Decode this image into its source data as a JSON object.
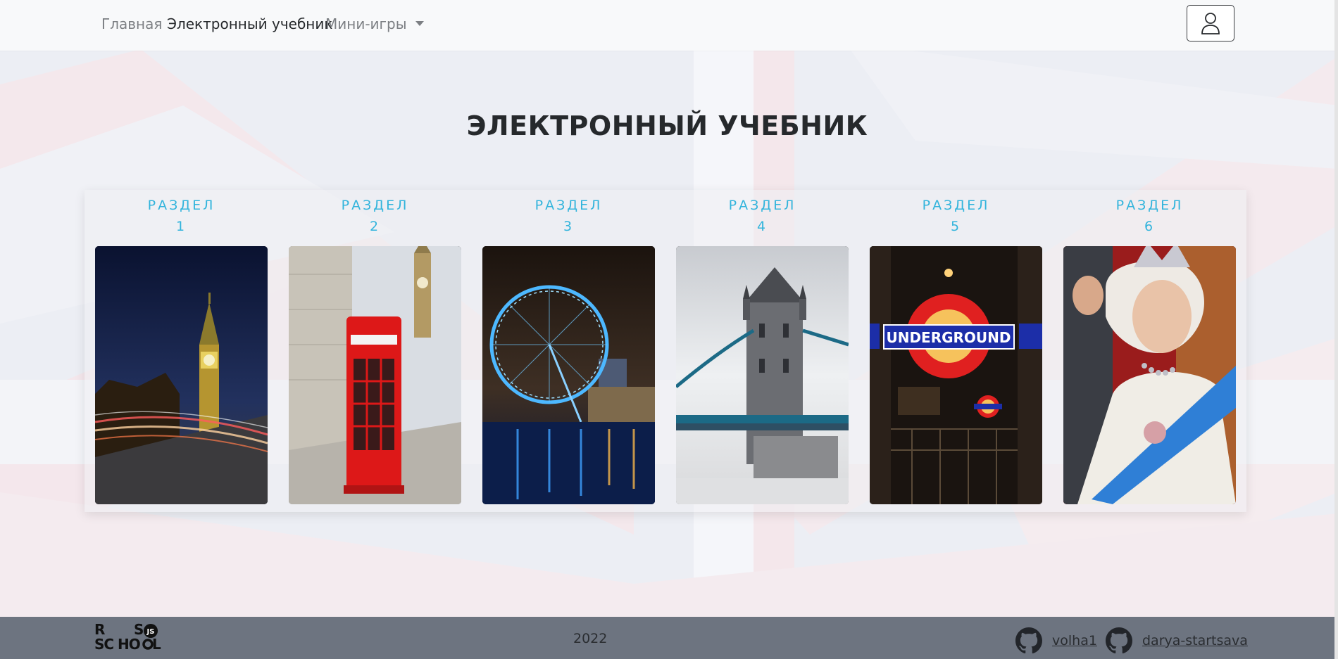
{
  "nav": {
    "home": "Главная",
    "textbook": "Электронный учебник",
    "games": "Мини-игры",
    "user_icon": "user-icon"
  },
  "page": {
    "title": "ЭЛЕКТРОННЫЙ УЧЕБНИК"
  },
  "sections": [
    {
      "label": "РАЗДЕЛ",
      "number": "1",
      "image": "big-ben-night"
    },
    {
      "label": "РАЗДЕЛ",
      "number": "2",
      "image": "red-telephone-box"
    },
    {
      "label": "РАЗДЕЛ",
      "number": "3",
      "image": "london-eye"
    },
    {
      "label": "РАЗДЕЛ",
      "number": "4",
      "image": "tower-bridge"
    },
    {
      "label": "РАЗДЕЛ",
      "number": "5",
      "image": "underground-sign"
    },
    {
      "label": "РАЗДЕЛ",
      "number": "6",
      "image": "queen-elizabeth"
    }
  ],
  "footer": {
    "logo_text": "RS SCHOOL JS",
    "year": "2022",
    "authors": [
      "volha1",
      "darya-startsava"
    ],
    "author_icon": "github-icon"
  },
  "colors": {
    "accent": "#32b4dc",
    "footer_bg": "#6d7480",
    "navbar_bg": "#f8f9fa"
  }
}
